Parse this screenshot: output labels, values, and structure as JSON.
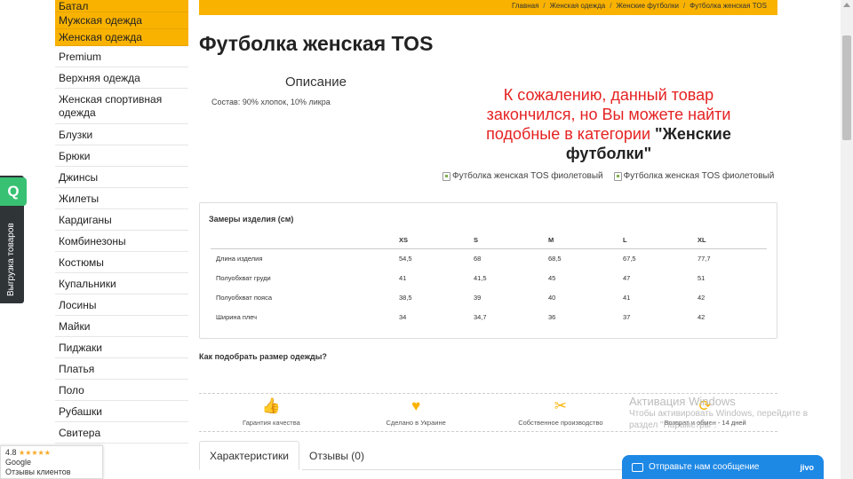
{
  "sidebar": {
    "items": [
      {
        "label": "Батал",
        "type": "orange"
      },
      {
        "label": "Мужская одежда",
        "type": "orange"
      },
      {
        "label": "Женская одежда",
        "type": "orange"
      },
      {
        "label": "Premium",
        "type": "normal"
      },
      {
        "label": "Верхняя одежда",
        "type": "normal"
      },
      {
        "label": "Женская спортивная одежда",
        "type": "tall"
      },
      {
        "label": "Блузки",
        "type": "normal"
      },
      {
        "label": "Брюки",
        "type": "normal"
      },
      {
        "label": "Джинсы",
        "type": "normal"
      },
      {
        "label": "Жилеты",
        "type": "normal"
      },
      {
        "label": "Кардиганы",
        "type": "normal"
      },
      {
        "label": "Комбинезоны",
        "type": "normal"
      },
      {
        "label": "Костюмы",
        "type": "normal"
      },
      {
        "label": "Купальники",
        "type": "normal"
      },
      {
        "label": "Лосины",
        "type": "normal"
      },
      {
        "label": "Майки",
        "type": "normal"
      },
      {
        "label": "Пиджаки",
        "type": "normal"
      },
      {
        "label": "Платья",
        "type": "normal"
      },
      {
        "label": "Поло",
        "type": "normal"
      },
      {
        "label": "Рубашки",
        "type": "normal"
      },
      {
        "label": "Свитера",
        "type": "normal"
      }
    ]
  },
  "export_tab": {
    "badge": "Q",
    "label": "Выгрузка товаров"
  },
  "breadcrumb": [
    "Главная",
    "Женская одежда",
    "Женские футболки",
    "Футболка женская TOS"
  ],
  "product": {
    "title": "Футболка женская TOS",
    "description_title": "Описание",
    "description_text": "Состав: 90% хлопок, 10% ликра",
    "soldout_text": "К сожалению, данный товар закончился, но Вы можете найти подобные в категории ",
    "soldout_category": "\"Женские футболки\"",
    "photo_alt_1": "Футболка женская TOS фиолетовый",
    "photo_alt_2": "Футболка женская TOS фиолетовый"
  },
  "size_chart": {
    "heading": "Замеры изделия (см)",
    "columns": [
      "",
      "XS",
      "S",
      "M",
      "L",
      "XL"
    ],
    "rows": [
      [
        "Длина изделия",
        "54,5",
        "68",
        "68,5",
        "67,5",
        "77,7"
      ],
      [
        "Полуобхват груди",
        "41",
        "41,5",
        "45",
        "47",
        "51"
      ],
      [
        "Полуобхват пояса",
        "38,5",
        "39",
        "40",
        "41",
        "42"
      ],
      [
        "Ширина плеч",
        "34",
        "34,7",
        "36",
        "37",
        "42"
      ]
    ]
  },
  "howto_link": "Как подобрать размер одежды?",
  "features": [
    {
      "icon": "thumbs-up-icon",
      "label": "Гарантия качества"
    },
    {
      "icon": "heart-icon",
      "label": "Сделано в Украине"
    },
    {
      "icon": "scissors-icon",
      "label": "Собственное производство"
    },
    {
      "icon": "refresh-icon",
      "label": "Возврат и обмен - 14 дней"
    }
  ],
  "tabs": [
    "Характеристики",
    "Отзывы (0)"
  ],
  "google_badge": {
    "rating": "4.8",
    "brand": "Google",
    "label": "Отзывы клиентов"
  },
  "jivo": {
    "label": "Отправьте нам сообщение",
    "brand": "jivo"
  },
  "windows_watermark": {
    "heading": "Активация Windows",
    "line1": "Чтобы активировать Windows, перейдите в",
    "line2": "раздел \"Параметры\"."
  },
  "colors": {
    "accent": "#f9b200",
    "soldout": "#e52222",
    "chat": "#1e88e5",
    "badge": "#38c172"
  }
}
